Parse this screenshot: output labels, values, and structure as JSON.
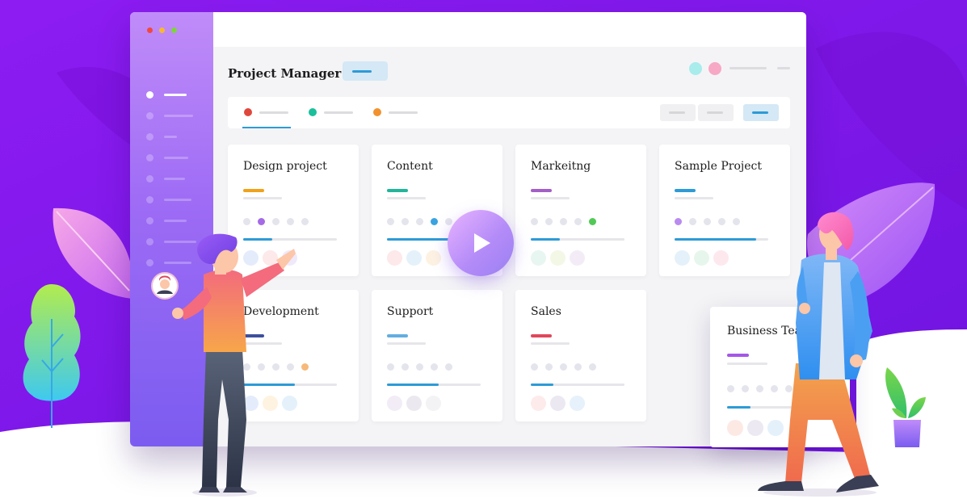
{
  "app": {
    "title": "Project Manager",
    "colors": {
      "accent": "#2d9bd6",
      "background_purple": "#8a17f0",
      "sidebar_top": "#c08cf9",
      "sidebar_bottom": "#7b5cf0"
    }
  },
  "window": {
    "traffic_lights": [
      "#f0483e",
      "#f7b733",
      "#7fd43b"
    ]
  },
  "sidebar": {
    "items": [
      {
        "icon": "menu-item-icon",
        "active": true
      },
      {
        "icon": "menu-item-icon",
        "active": false
      },
      {
        "icon": "menu-item-icon",
        "active": false
      },
      {
        "icon": "menu-item-icon",
        "active": false
      },
      {
        "icon": "menu-item-icon",
        "active": false
      },
      {
        "icon": "menu-item-icon",
        "active": false
      },
      {
        "icon": "menu-item-icon",
        "active": false
      },
      {
        "icon": "menu-item-icon",
        "active": false
      },
      {
        "icon": "menu-item-icon",
        "active": false
      }
    ]
  },
  "header": {
    "user_avatars": [
      "#a8ecec",
      "#f7a8c4"
    ]
  },
  "filters": {
    "tabs": [
      {
        "color": "#e0473c",
        "active": true
      },
      {
        "color": "#1bbf9c",
        "active": false
      },
      {
        "color": "#f2922e",
        "active": false
      }
    ]
  },
  "projects": [
    {
      "title": "Design project",
      "accent": "#f0a21b",
      "dots": [
        "#e4e4ec",
        "#a56ae6",
        "#e4e4ec",
        "#e4e4ec",
        "#e4e4ec"
      ],
      "progress": 0.31,
      "members": [
        "#e4ecfb",
        "#fde8ea",
        "#efe9fb"
      ]
    },
    {
      "title": "Content",
      "accent": "#22b59a",
      "dots": [
        "#e4e4ec",
        "#e4e4ec",
        "#e4e4ec",
        "#3aa3e0",
        "#e4e4ec"
      ],
      "progress": 0.78,
      "members": [
        "#fde8ea",
        "#e4f1fb",
        "#fdf2e2"
      ]
    },
    {
      "title": "Markeitng",
      "accent": "#a35ec7",
      "dots": [
        "#e4e4ec",
        "#e4e4ec",
        "#e4e4ec",
        "#e4e4ec",
        "#52c957"
      ],
      "progress": 0.31,
      "members": [
        "#e7f6f1",
        "#f3f7e6",
        "#f3ecf6"
      ]
    },
    {
      "title": "Sample Project",
      "accent": "#2d9bd6",
      "dots": [
        "#b98af0",
        "#e4e4ec",
        "#e4e4ec",
        "#e4e4ec",
        "#e4e4ec"
      ],
      "progress": 0.87,
      "members": [
        "#e4f1fb",
        "#e7f6ec",
        "#fde8ee"
      ]
    },
    {
      "title": "Development",
      "accent": "#3d4f9c",
      "dots": [
        "#e4e4ec",
        "#e4e4ec",
        "#e4e4ec",
        "#e4e4ec",
        "#f6b97a"
      ],
      "progress": 0.55,
      "members": [
        "#e4ecfb",
        "#fdf3e0",
        "#e4f1fb"
      ]
    },
    {
      "title": "Support",
      "accent": "#62aee0",
      "dots": [
        "#e4e4ec",
        "#e4e4ec",
        "#e4e4ec",
        "#e4e4ec",
        "#e4e4ec"
      ],
      "progress": 0.55,
      "members": [
        "#f1ecf6",
        "#ebe8ef",
        "#f3f3f5"
      ]
    },
    {
      "title": "Sales",
      "accent": "#e0475b",
      "dots": [
        "#e4e4ec",
        "#e4e4ec",
        "#e4e4ec",
        "#e4e4ec",
        "#e4e4ec"
      ],
      "progress": 0.24,
      "members": [
        "#fdebeb",
        "#ebe8f2",
        "#e6f1fb"
      ]
    }
  ],
  "floating_card": {
    "title": "Business Team",
    "accent": "#a557e6",
    "dots": [
      "#e4e4ec",
      "#e4e4ec",
      "#e4e4ec",
      "#e4e4ec",
      "#e4e4ec"
    ],
    "progress": 0.24,
    "members": [
      "#fde9e4",
      "#ece9f3",
      "#e4f1fb"
    ]
  },
  "media": {
    "play_icon": "play-icon"
  }
}
